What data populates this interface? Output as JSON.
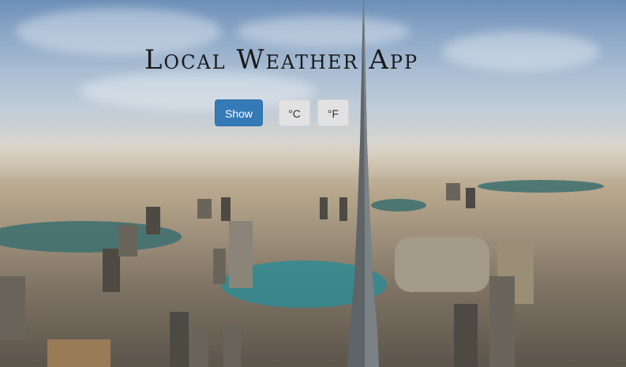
{
  "app": {
    "title": "Local Weather App"
  },
  "controls": {
    "show_label": "Show",
    "celsius_label": "°C",
    "fahrenheit_label": "°F"
  },
  "colors": {
    "primary_button": "#337ab7",
    "secondary_button": "#e2e2e2",
    "title_text": "#1b1b1b"
  }
}
